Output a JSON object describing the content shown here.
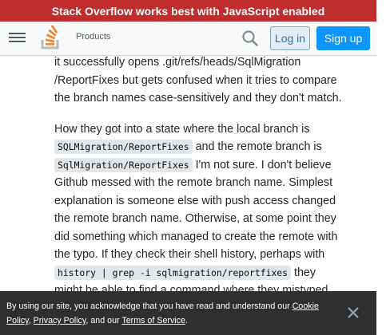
{
  "banner": {
    "text": "Stack Overflow works best with JavaScript enabled"
  },
  "header": {
    "products_label": "Products",
    "login_label": "Log in",
    "signup_label": "Sign up",
    "colors": {
      "accent": "#f48024",
      "signup": "#0a95ff",
      "banner": "#c02d2e"
    },
    "icons": [
      "hamburger-menu-icon",
      "stack-overflow-logo-icon",
      "search-icon"
    ]
  },
  "post": {
    "p1": {
      "l1": "it successfully opens .git/refs/heads/SqlMigration",
      "l2": "/ReportFixes but gets confused when it tries to compare",
      "l3": "the branch names case-sensitively and they don't match."
    },
    "p2": {
      "l1": "How they got into a state where the local branch is",
      "code1": "SQLMigration/ReportFixes",
      "l2_after": " and the remote branch is",
      "code2": "SqlMigration/ReportFixes",
      "l3_after": " I'm not sure. I don't believe",
      "l4": "Github messed with the remote branch name. Simplest",
      "l5": "explanation is someone else with push access changed",
      "l6": "the remote branch name. Otherwise, at some point they",
      "l7": "did something which managed to create the remote with",
      "l8": "the typo. If they check their shell history, perhaps with",
      "code3": "history | grep -i sqlmigration/reportfixes",
      "l9_after": " they",
      "l10": "might be able to find a command where they mistyped"
    }
  },
  "cookie": {
    "text_prefix": "By using our site, you acknowledge that you have read and understand our ",
    "cookie_policy": "Cookie Policy",
    "sep1": ", ",
    "privacy_policy": "Privacy Policy",
    "sep2": ", and our ",
    "terms": "Terms of Service",
    "suffix": ".",
    "close_icon": "close-icon"
  }
}
